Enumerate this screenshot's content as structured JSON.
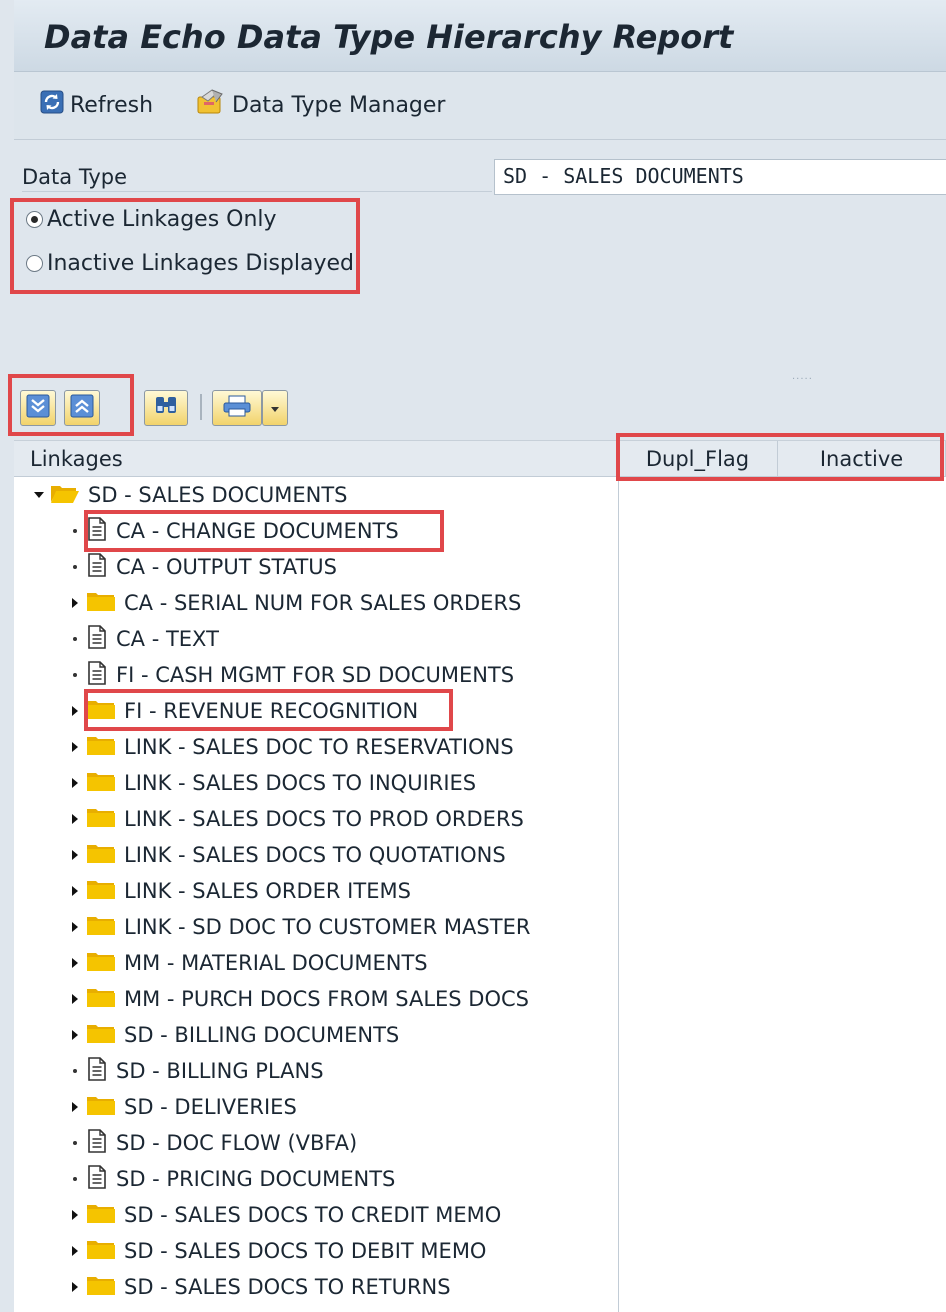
{
  "app": {
    "title": "Data Echo Data Type Hierarchy Report"
  },
  "toolbar": {
    "refresh_label": "Refresh",
    "data_type_manager_label": "Data Type Manager"
  },
  "selection": {
    "data_type_label": "Data Type",
    "data_type_value": "SD - SALES DOCUMENTS",
    "radio_active_label": "Active Linkages Only",
    "radio_active_checked": true,
    "radio_inactive_label": "Inactive Linkages Displayed",
    "radio_inactive_checked": false
  },
  "alv_toolbar": {
    "buttons": [
      "expand-all-icon",
      "collapse-all-icon",
      "find-icon",
      "print-icon",
      "dropdown-icon"
    ]
  },
  "columns": {
    "linkages": "Linkages",
    "dupl_flag": "Dupl_Flag",
    "inactive": "Inactive"
  },
  "tree": {
    "root": {
      "label": "SD - SALES DOCUMENTS",
      "icon": "folder-open-icon",
      "expanded": true
    },
    "children": [
      {
        "label": "CA - CHANGE DOCUMENTS",
        "icon": "document-icon",
        "expandable": false
      },
      {
        "label": "CA - OUTPUT STATUS",
        "icon": "document-icon",
        "expandable": false
      },
      {
        "label": "CA - SERIAL NUM FOR SALES ORDERS",
        "icon": "folder-icon",
        "expandable": true
      },
      {
        "label": "CA - TEXT",
        "icon": "document-icon",
        "expandable": false
      },
      {
        "label": "FI - CASH MGMT FOR SD DOCUMENTS",
        "icon": "document-icon",
        "expandable": false
      },
      {
        "label": "FI - REVENUE RECOGNITION",
        "icon": "folder-icon",
        "expandable": true
      },
      {
        "label": "LINK - SALES DOC TO RESERVATIONS",
        "icon": "folder-icon",
        "expandable": true
      },
      {
        "label": "LINK - SALES DOCS TO INQUIRIES",
        "icon": "folder-icon",
        "expandable": true
      },
      {
        "label": "LINK - SALES DOCS TO PROD ORDERS",
        "icon": "folder-icon",
        "expandable": true
      },
      {
        "label": "LINK - SALES DOCS TO QUOTATIONS",
        "icon": "folder-icon",
        "expandable": true
      },
      {
        "label": "LINK - SALES ORDER ITEMS",
        "icon": "folder-icon",
        "expandable": true
      },
      {
        "label": "LINK - SD DOC TO CUSTOMER MASTER",
        "icon": "folder-icon",
        "expandable": true
      },
      {
        "label": "MM - MATERIAL DOCUMENTS",
        "icon": "folder-icon",
        "expandable": true
      },
      {
        "label": "MM - PURCH DOCS FROM SALES DOCS",
        "icon": "folder-icon",
        "expandable": true
      },
      {
        "label": "SD - BILLING DOCUMENTS",
        "icon": "folder-icon",
        "expandable": true
      },
      {
        "label": "SD - BILLING PLANS",
        "icon": "document-icon",
        "expandable": false
      },
      {
        "label": "SD - DELIVERIES",
        "icon": "folder-icon",
        "expandable": true
      },
      {
        "label": "SD - DOC FLOW (VBFA)",
        "icon": "document-icon",
        "expandable": false
      },
      {
        "label": "SD - PRICING DOCUMENTS",
        "icon": "document-icon",
        "expandable": false
      },
      {
        "label": "SD - SALES DOCS TO CREDIT MEMO",
        "icon": "folder-icon",
        "expandable": true
      },
      {
        "label": "SD - SALES DOCS TO DEBIT MEMO",
        "icon": "folder-icon",
        "expandable": true
      },
      {
        "label": "SD - SALES DOCS TO RETURNS",
        "icon": "folder-icon",
        "expandable": true
      }
    ]
  },
  "colors": {
    "highlight_border": "#e0474a",
    "folder_yellow": "#f5c400",
    "background": "#dfe6ed"
  }
}
